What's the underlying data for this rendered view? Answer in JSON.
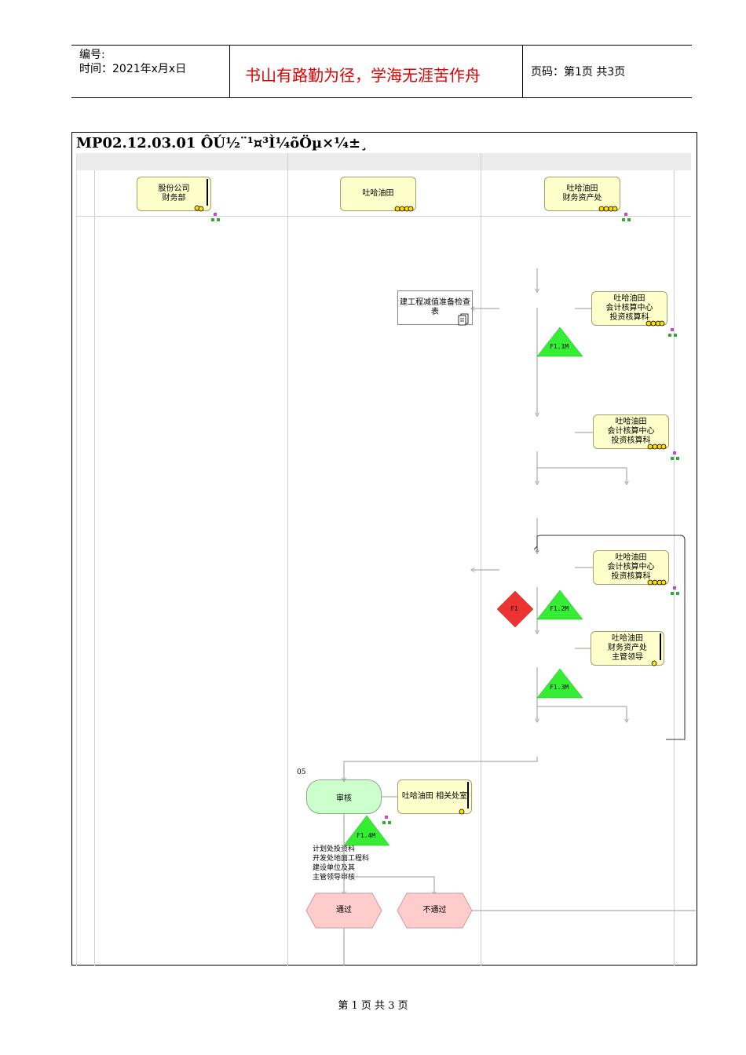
{
  "header": {
    "number_label": "编号:",
    "time_label": "时间：2021年x月x日",
    "motto": "书山有路勤为径，学海无涯苦作舟",
    "page_label": "页码：第1页  共3页"
  },
  "diagram": {
    "title": "MP02.12.03.01 ÔÚ½¨¹¤³Ì¼õÖµ×¼±¸",
    "lanes": [
      {
        "role": "股份公司\n财务部"
      },
      {
        "role": "吐哈油田"
      },
      {
        "role": "吐哈油田\n财务资产处"
      }
    ],
    "roles": {
      "acct1": "吐哈油田\n会计核算中心\n投资核算科",
      "acct2": "吐哈油田\n会计核算中心\n投资核算科",
      "acct3": "吐哈油田\n会计核算中心\n投资核算科",
      "leader": "吐哈油田\n财务资产处\n主管领导",
      "related": "吐哈油田  相关处室"
    },
    "document": "建工程减值准备检查\n表",
    "markers": {
      "f11": "F1.1M",
      "f12": "F1.2M",
      "f13": "F1.3M",
      "f14": "F1.4M",
      "f1": "F1"
    },
    "step_number": "05",
    "review": "审核",
    "reviewers": "计划处投资科\n开发处地面工程科\n建设单位及其\n主管领导审核",
    "pass": "通过",
    "fail": "不通过"
  },
  "footer": {
    "page": "第 1 页 共 3 页"
  },
  "colors": {
    "motto": "#e00000",
    "role_fill": "#ffffcc",
    "process_fill": "#ccffcc",
    "marker_green": "#33ee33",
    "decision_red": "#ee3333",
    "end_fill": "#ffcccc"
  }
}
